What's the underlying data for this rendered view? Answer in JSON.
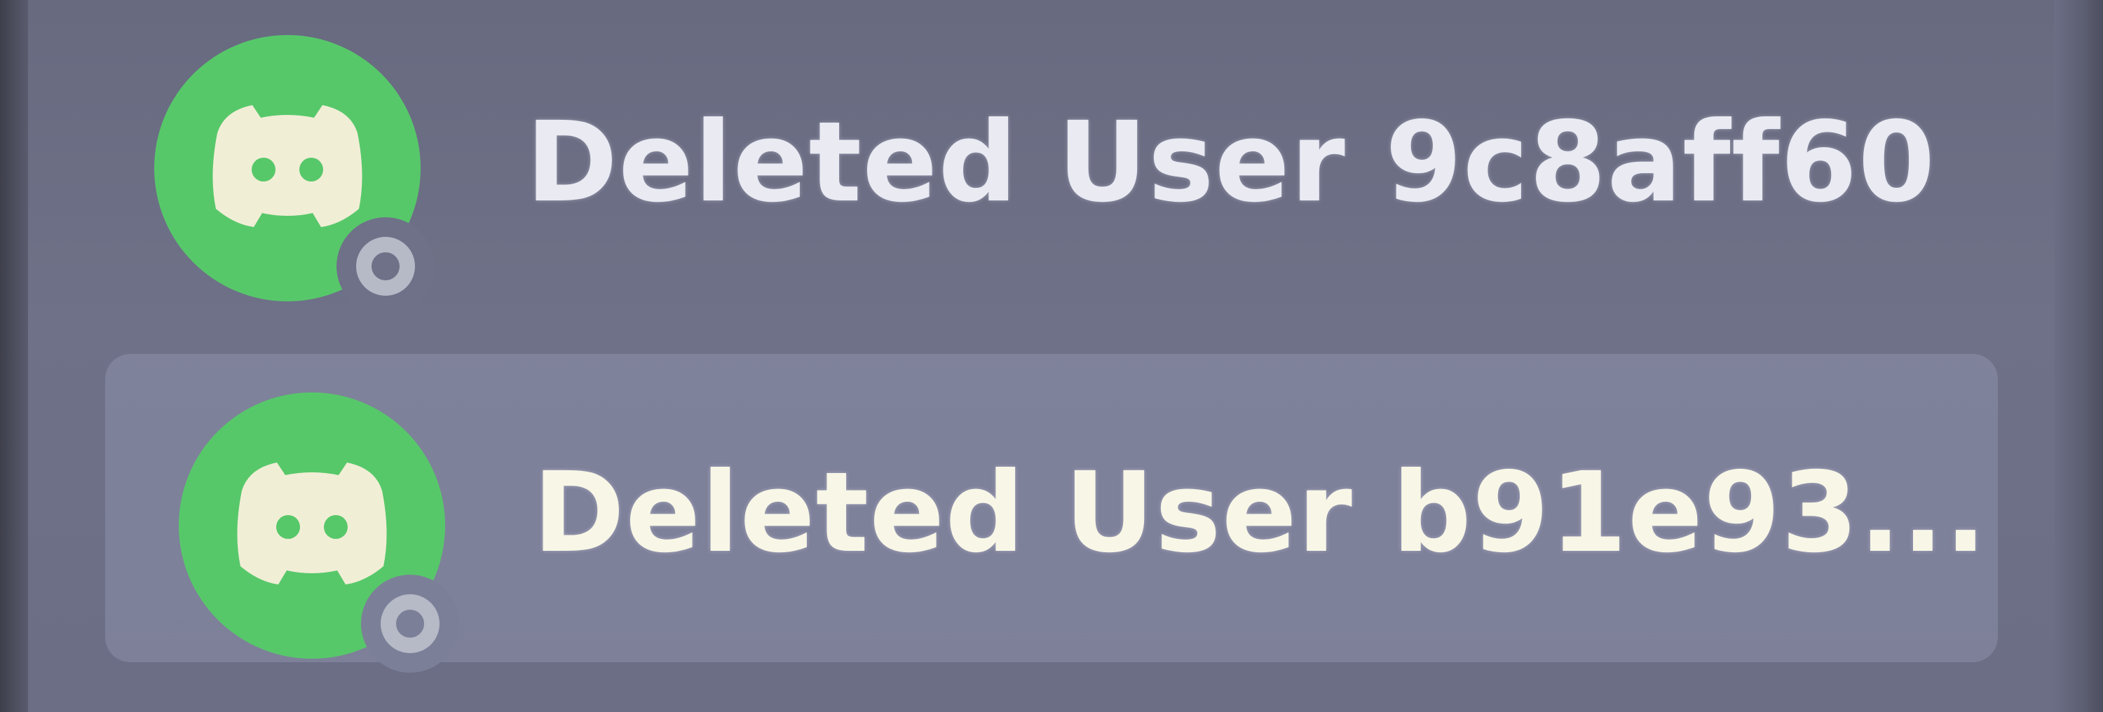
{
  "member_list": {
    "members": [
      {
        "name": "Deleted User 9c8aff60",
        "avatar_icon": "discord-logo-icon",
        "avatar_color": "#57c86a",
        "status": "offline",
        "status_icon": "offline-status-icon",
        "hovered": false
      },
      {
        "name": "Deleted User b91e93...",
        "avatar_icon": "discord-logo-icon",
        "avatar_color": "#57c86a",
        "status": "offline",
        "status_icon": "offline-status-icon",
        "hovered": true
      }
    ]
  }
}
